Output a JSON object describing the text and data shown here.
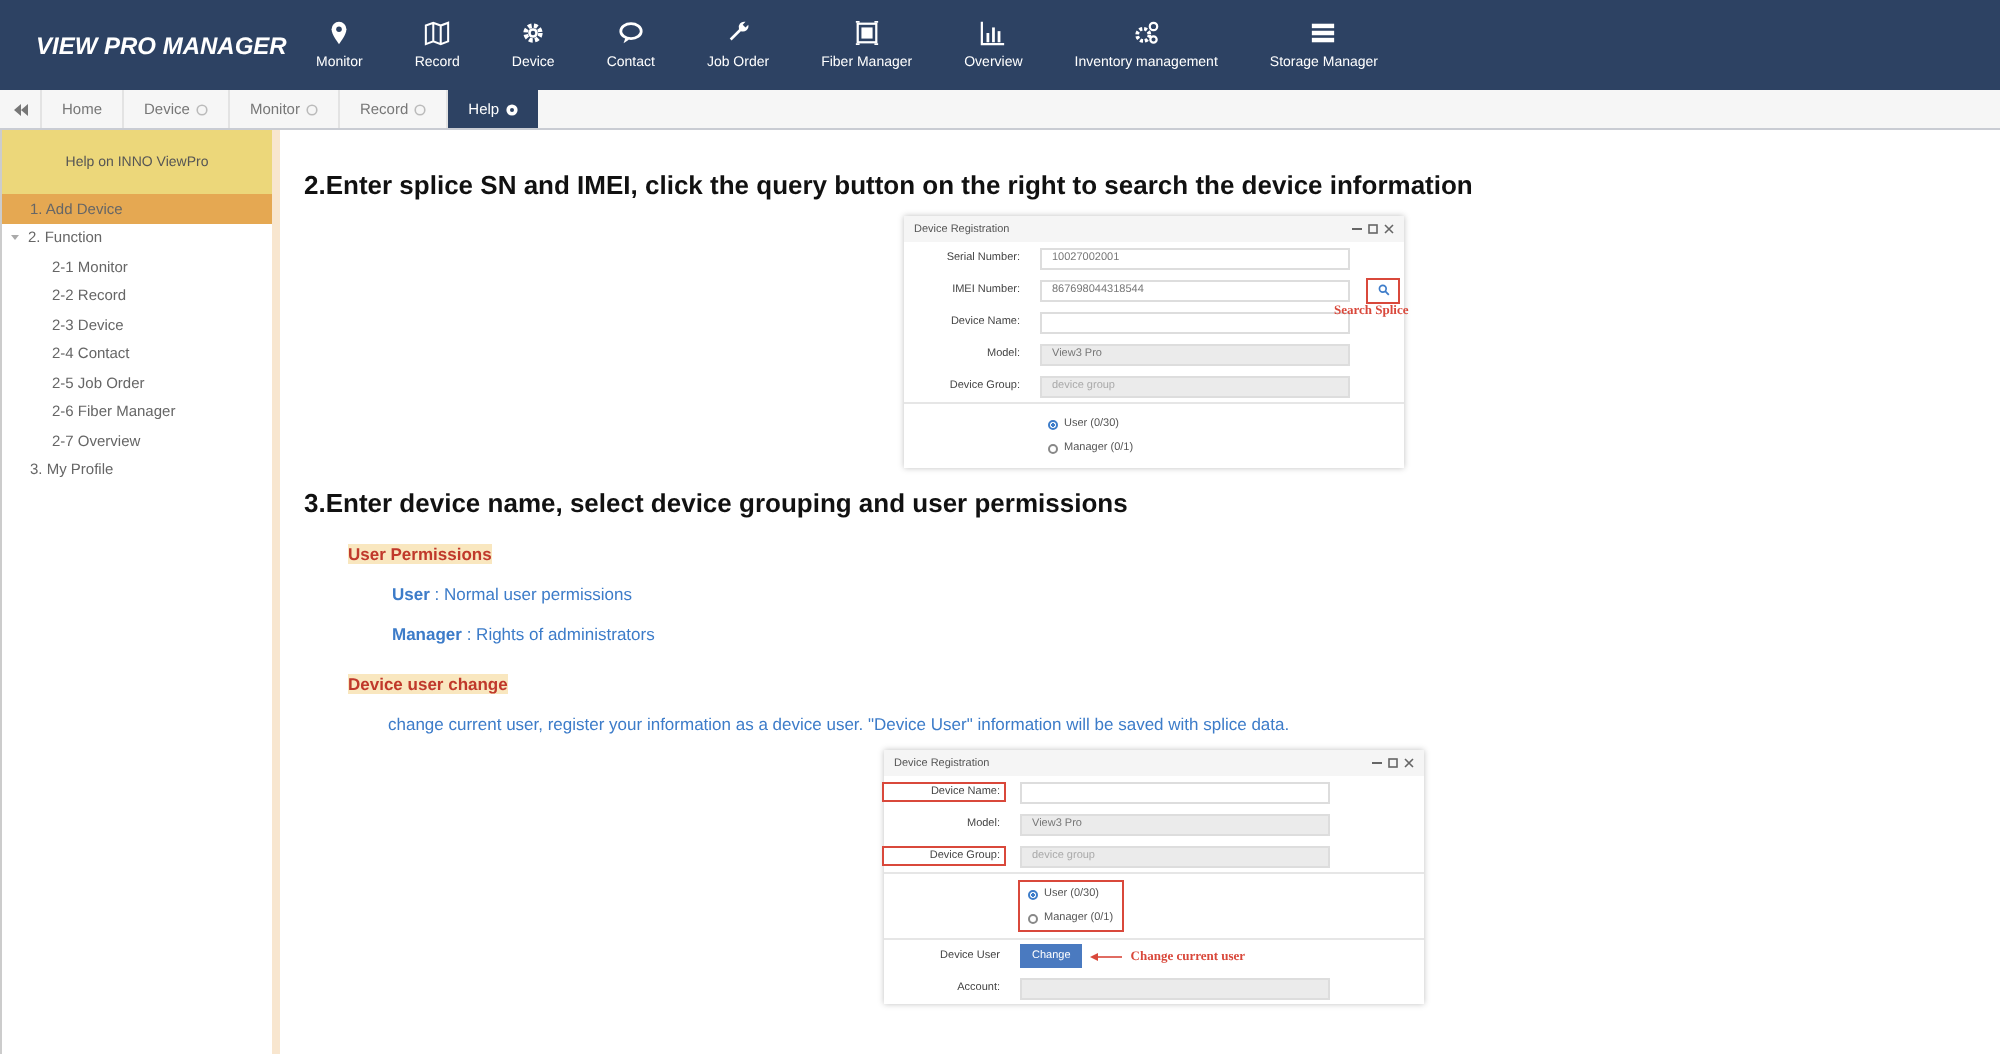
{
  "header": {
    "logo": "VIEW PRO MANAGER",
    "nav": [
      {
        "label": "Monitor",
        "kind": "pin"
      },
      {
        "label": "Record",
        "kind": "map"
      },
      {
        "label": "Device",
        "kind": "gear"
      },
      {
        "label": "Contact",
        "kind": "chat"
      },
      {
        "label": "Job Order",
        "kind": "wrench"
      },
      {
        "label": "Fiber Manager",
        "kind": "frame"
      },
      {
        "label": "Overview",
        "kind": "chart"
      },
      {
        "label": "Inventory management",
        "kind": "gears"
      },
      {
        "label": "Storage Manager",
        "kind": "list"
      }
    ]
  },
  "tabs": [
    {
      "label": "Home",
      "closable": false,
      "selected": false
    },
    {
      "label": "Device",
      "closable": true,
      "selected": false
    },
    {
      "label": "Monitor",
      "closable": true,
      "selected": false
    },
    {
      "label": "Record",
      "closable": true,
      "selected": false
    },
    {
      "label": "Help",
      "closable": true,
      "selected": true
    }
  ],
  "sidebar": {
    "title": "Help on INNO ViewPro",
    "items": [
      {
        "label": "1. Add Device",
        "selected": true
      },
      {
        "label": "2. Function",
        "selected": false,
        "expanded": true,
        "children": [
          {
            "label": "2-1 Monitor",
            "selected": false
          },
          {
            "label": "2-2 Record",
            "selected": false
          },
          {
            "label": "2-3 Device",
            "selected": false
          },
          {
            "label": "2-4 Contact",
            "selected": false
          },
          {
            "label": "2-5 Job Order",
            "selected": false
          },
          {
            "label": "2-6 Fiber Manager",
            "selected": false
          },
          {
            "label": "2-7 Overview",
            "selected": false
          }
        ]
      },
      {
        "label": "3. My Profile",
        "selected": false
      }
    ]
  },
  "content": [
    {
      "kind": "heading",
      "text": "2.Enter splice SN and IMEI, click the query button on the right to search the device information"
    },
    {
      "kind": "screenshot",
      "title": "Device Registration",
      "rows": [
        {
          "kind": "input",
          "label": "Serial Number:",
          "value": "10027002001",
          "highlighted": false
        },
        {
          "kind": "input",
          "label": "IMEI Number:",
          "value": "867698044318544",
          "highlighted": false,
          "search_button": {
            "highlighted": true,
            "annotation": "Search Splice"
          }
        },
        {
          "kind": "input",
          "label": "Device Name:",
          "highlighted": false
        },
        {
          "kind": "readonly",
          "label": "Model:",
          "value": "View3 Pro",
          "highlighted": false
        },
        {
          "kind": "readonly",
          "label": "Device Group:",
          "placeholder": "device group",
          "highlighted": false
        },
        {
          "kind": "radios",
          "highlighted": false,
          "options": [
            {
              "label": "User (0/30)",
              "selected": true
            },
            {
              "label": "Manager (0/1)",
              "selected": false
            }
          ]
        }
      ]
    },
    {
      "kind": "heading",
      "text": "3.Enter device name,  select device grouping and user permissions"
    },
    {
      "kind": "subheading",
      "text": "User Permissions"
    },
    {
      "kind": "definition",
      "text": "**User** : Normal user permissions"
    },
    {
      "kind": "definition",
      "text": "**Manager** : Rights of administrators"
    },
    {
      "kind": "subheading",
      "text": "Device user change"
    },
    {
      "kind": "paragraph",
      "text": "change current user, register your information as a device user. \"Device User\" information will be saved with splice data."
    },
    {
      "kind": "screenshot",
      "title": "Device Registration",
      "rows": [
        {
          "kind": "input",
          "label": "Device Name:",
          "highlighted": true
        },
        {
          "kind": "readonly",
          "label": "Model:",
          "value": "View3 Pro",
          "highlighted": false
        },
        {
          "kind": "readonly",
          "label": "Device Group:",
          "placeholder": "device group",
          "highlighted": true
        },
        {
          "kind": "radios",
          "highlighted": true,
          "options": [
            {
              "label": "User (0/30)",
              "selected": true
            },
            {
              "label": "Manager (0/1)",
              "selected": false
            }
          ]
        },
        {
          "kind": "button",
          "label": "Device User",
          "button": "Change",
          "annotation": "Change current user",
          "highlighted": false
        },
        {
          "kind": "readonly",
          "label": "Account:",
          "highlighted": false
        }
      ]
    }
  ]
}
